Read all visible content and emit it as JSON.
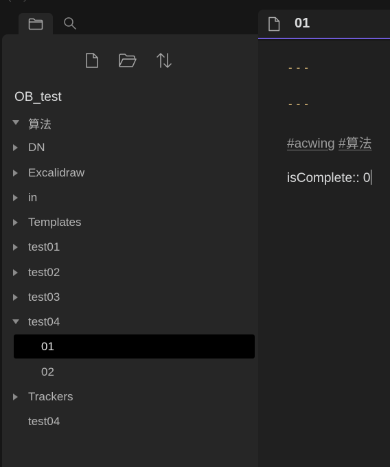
{
  "sidebar": {
    "vault_name": "OB_test",
    "items": [
      {
        "label": "算法",
        "expanded": true
      },
      {
        "label": "DN",
        "expanded": false
      },
      {
        "label": "Excalidraw",
        "expanded": false
      },
      {
        "label": "in",
        "expanded": false
      },
      {
        "label": "Templates",
        "expanded": false
      },
      {
        "label": "test01",
        "expanded": false
      },
      {
        "label": "test02",
        "expanded": false
      },
      {
        "label": "test03",
        "expanded": false
      },
      {
        "label": "test04",
        "expanded": true
      },
      {
        "label": "01",
        "active": true
      },
      {
        "label": "02"
      },
      {
        "label": "Trackers",
        "expanded": false
      },
      {
        "label": "test04"
      }
    ]
  },
  "tab": {
    "title": "01"
  },
  "editor": {
    "hr1": "---",
    "hr2": "---",
    "tag1": "#acwing",
    "tag2": "#算法",
    "property": "isComplete:: 0"
  },
  "colors": {
    "accent": "#6e5ad6",
    "hr": "#e5c07b",
    "active_row": "#000000",
    "sidebar_bg": "#262626",
    "editor_bg": "#202020"
  },
  "icons": [
    "folder-icon",
    "search-icon",
    "new-note-icon",
    "new-folder-icon",
    "sort-icon",
    "file-icon",
    "collapse-arrow-icon",
    "expand-arrow-icon"
  ]
}
